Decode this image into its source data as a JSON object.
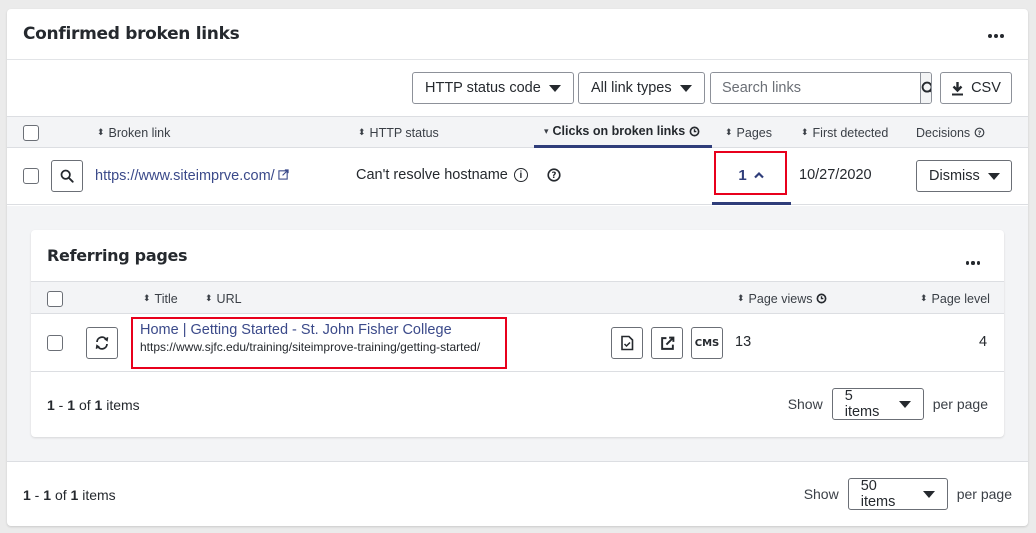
{
  "card": {
    "title": "Confirmed broken links",
    "more_icon": "ellipsis-icon"
  },
  "toolbar": {
    "http_status_filter": "HTTP status code",
    "link_types_filter": "All link types",
    "search_placeholder": "Search links",
    "search_icon": "search-icon",
    "csv_label": "CSV",
    "csv_icon": "download-icon"
  },
  "table": {
    "columns": [
      {
        "label": "Broken link",
        "sort": "sortable"
      },
      {
        "label": "HTTP status",
        "sort": "sortable"
      },
      {
        "label": "Clicks on broken links",
        "sort": "descending",
        "icon": "history-icon"
      },
      {
        "label": "Pages",
        "sort": "sortable"
      },
      {
        "label": "First detected",
        "sort": "sortable"
      },
      {
        "label": "Decisions",
        "icon": "help-icon"
      }
    ],
    "rows": [
      {
        "broken_link": "https://www.siteimprve.com/",
        "http_status": "Can't resolve hostname",
        "clicks_icon": "help-icon",
        "pages": "1",
        "first_detected": "10/27/2020",
        "decision": "Dismiss"
      }
    ]
  },
  "referring": {
    "title": "Referring pages",
    "columns": [
      {
        "label": "Title",
        "sort": "sortable"
      },
      {
        "label": "URL",
        "sort": "sortable"
      },
      {
        "label": "Page views",
        "sort": "sortable",
        "icon": "history-icon"
      },
      {
        "label": "Page level",
        "sort": "sortable"
      }
    ],
    "rows": [
      {
        "title": "Home | Getting Started - St. John Fisher College",
        "url": "https://www.sjfc.edu/training/siteimprove-training/getting-started/",
        "actions": [
          "page-report-icon",
          "open-external-icon",
          "CMS"
        ],
        "page_views": "13",
        "page_level": "4"
      }
    ],
    "pager": {
      "range_start": "1",
      "range_end": "1",
      "total": "1",
      "of": "of",
      "items": "items",
      "show": "Show",
      "per_page_value": "5 items",
      "per_page": "per page"
    }
  },
  "pager": {
    "range_start": "1",
    "range_end": "1",
    "total": "1",
    "of": "of",
    "items": "items",
    "show": "Show",
    "per_page_value": "50 items",
    "per_page": "per page"
  },
  "colors": {
    "link": "#3b4a8a",
    "highlight": "#e8001c",
    "active_underline": "#2f3d7a"
  }
}
